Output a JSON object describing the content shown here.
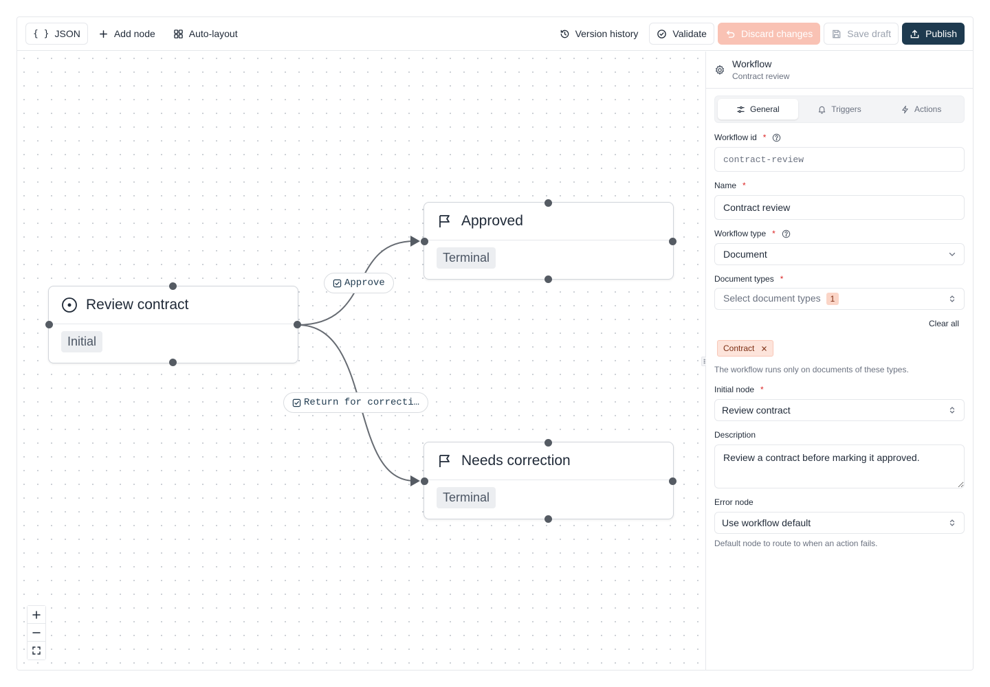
{
  "toolbar": {
    "json_label": "JSON",
    "add_node_label": "Add node",
    "auto_layout_label": "Auto-layout",
    "version_history_label": "Version history",
    "validate_label": "Validate",
    "discard_label": "Discard changes",
    "save_draft_label": "Save draft",
    "publish_label": "Publish"
  },
  "graph": {
    "nodes": {
      "review": {
        "title": "Review contract",
        "kind": "Initial"
      },
      "approved": {
        "title": "Approved",
        "kind": "Terminal"
      },
      "needs_correction": {
        "title": "Needs correction",
        "kind": "Terminal"
      }
    },
    "edges": {
      "approve": "Approve",
      "return": "Return for correcti…"
    }
  },
  "panel": {
    "title": "Workflow",
    "subtitle": "Contract review",
    "tabs": [
      "General",
      "Triggers",
      "Actions"
    ],
    "active_tab": "General",
    "fields": {
      "workflow_id": {
        "label": "Workflow id",
        "value": "contract-review"
      },
      "name": {
        "label": "Name",
        "value": "Contract review"
      },
      "workflow_type": {
        "label": "Workflow type",
        "value": "Document"
      },
      "document_types": {
        "label": "Document types",
        "placeholder": "Select document types",
        "count": "1",
        "clear_all": "Clear all",
        "selected": [
          "Contract"
        ],
        "hint": "The workflow runs only on documents of these types."
      },
      "initial_node": {
        "label": "Initial node",
        "value": "Review contract"
      },
      "description": {
        "label": "Description",
        "value": "Review a contract before marking it approved."
      },
      "error_node": {
        "label": "Error node",
        "value": "Use workflow default",
        "hint": "Default node to route to when an action fails."
      }
    }
  },
  "colors": {
    "primary": "#1e3a4f",
    "discard": "#f9c2b4",
    "tag_bg": "#fde4db",
    "handle": "#555b63",
    "required": "#dc2626"
  }
}
